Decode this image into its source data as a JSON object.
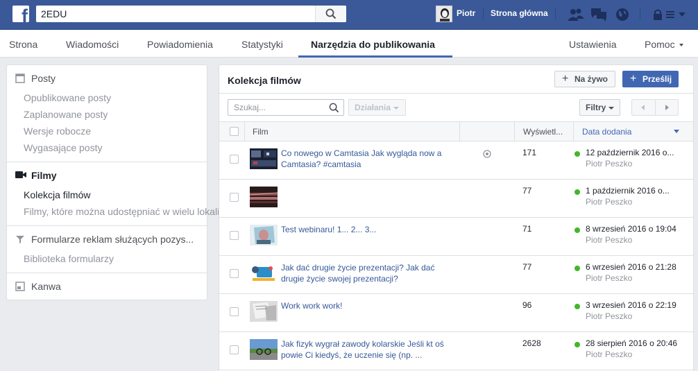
{
  "topbar": {
    "search_value": "2EDU",
    "user_name": "Piotr",
    "home_label": "Strona główna",
    "icons": [
      "friend-requests-icon",
      "messages-icon",
      "notifications-globe-icon",
      "lock-icon",
      "menu-caret-icon"
    ]
  },
  "pagenav": {
    "items": [
      "Strona",
      "Wiadomości",
      "Powiadomienia",
      "Statystyki",
      "Narzędzia do publikowania"
    ],
    "active": "Narzędzia do publikowania",
    "settings": "Ustawienia",
    "help": "Pomoc"
  },
  "sidebar": {
    "posts": {
      "label": "Posty",
      "items": [
        "Opublikowane posty",
        "Zaplanowane posty",
        "Wersje robocze",
        "Wygasające posty"
      ]
    },
    "videos": {
      "label": "Filmy",
      "items": [
        "Kolekcja filmów",
        "Filmy, które można udostępniać w wielu lokalizacjach"
      ]
    },
    "forms": {
      "label": "Formularze reklam służących pozys...",
      "items": [
        "Biblioteka formularzy"
      ]
    },
    "canvas": {
      "label": "Kanwa"
    }
  },
  "main": {
    "title": "Kolekcja filmów",
    "live_button": "Na żywo",
    "upload_button": "Prześlij",
    "search_placeholder": "Szukaj...",
    "actions_button": "Działania",
    "filters_button": "Filtry",
    "columns": {
      "film": "Film",
      "views": "Wyświetl...",
      "date": "Data dodania"
    }
  },
  "videos": [
    {
      "title": "Co nowego w Camtasia Jak wygląda now a Camtasia? #camtasia",
      "views": "171",
      "date": "12 październik 2016 o...",
      "author": "Piotr Peszko",
      "has_icon": true
    },
    {
      "title": "",
      "views": "77",
      "date": "1 październik 2016 o...",
      "author": "Piotr Peszko"
    },
    {
      "title": "Test webinaru! 1... 2... 3...",
      "views": "71",
      "date": "8 wrzesień 2016 o 19:04",
      "author": "Piotr Peszko"
    },
    {
      "title": "Jak dać drugie życie prezentacji? Jak dać drugie życie swojej prezentacji?",
      "views": "77",
      "date": "6 wrzesień 2016 o 21:28",
      "author": "Piotr Peszko"
    },
    {
      "title": "Work work work!",
      "views": "96",
      "date": "3 wrzesień 2016 o 22:19",
      "author": "Piotr Peszko"
    },
    {
      "title": "Jak fizyk wygrał zawody kolarskie Jeśli kt oś powie Ci kiedyś, że uczenie się (np. ...",
      "views": "2628",
      "date": "28 sierpień 2016 o 20:46",
      "author": "Piotr Peszko"
    }
  ],
  "colors": {
    "brand": "#3b5998",
    "link": "#365899",
    "accent": "#4267b2",
    "published": "#42b72a"
  }
}
